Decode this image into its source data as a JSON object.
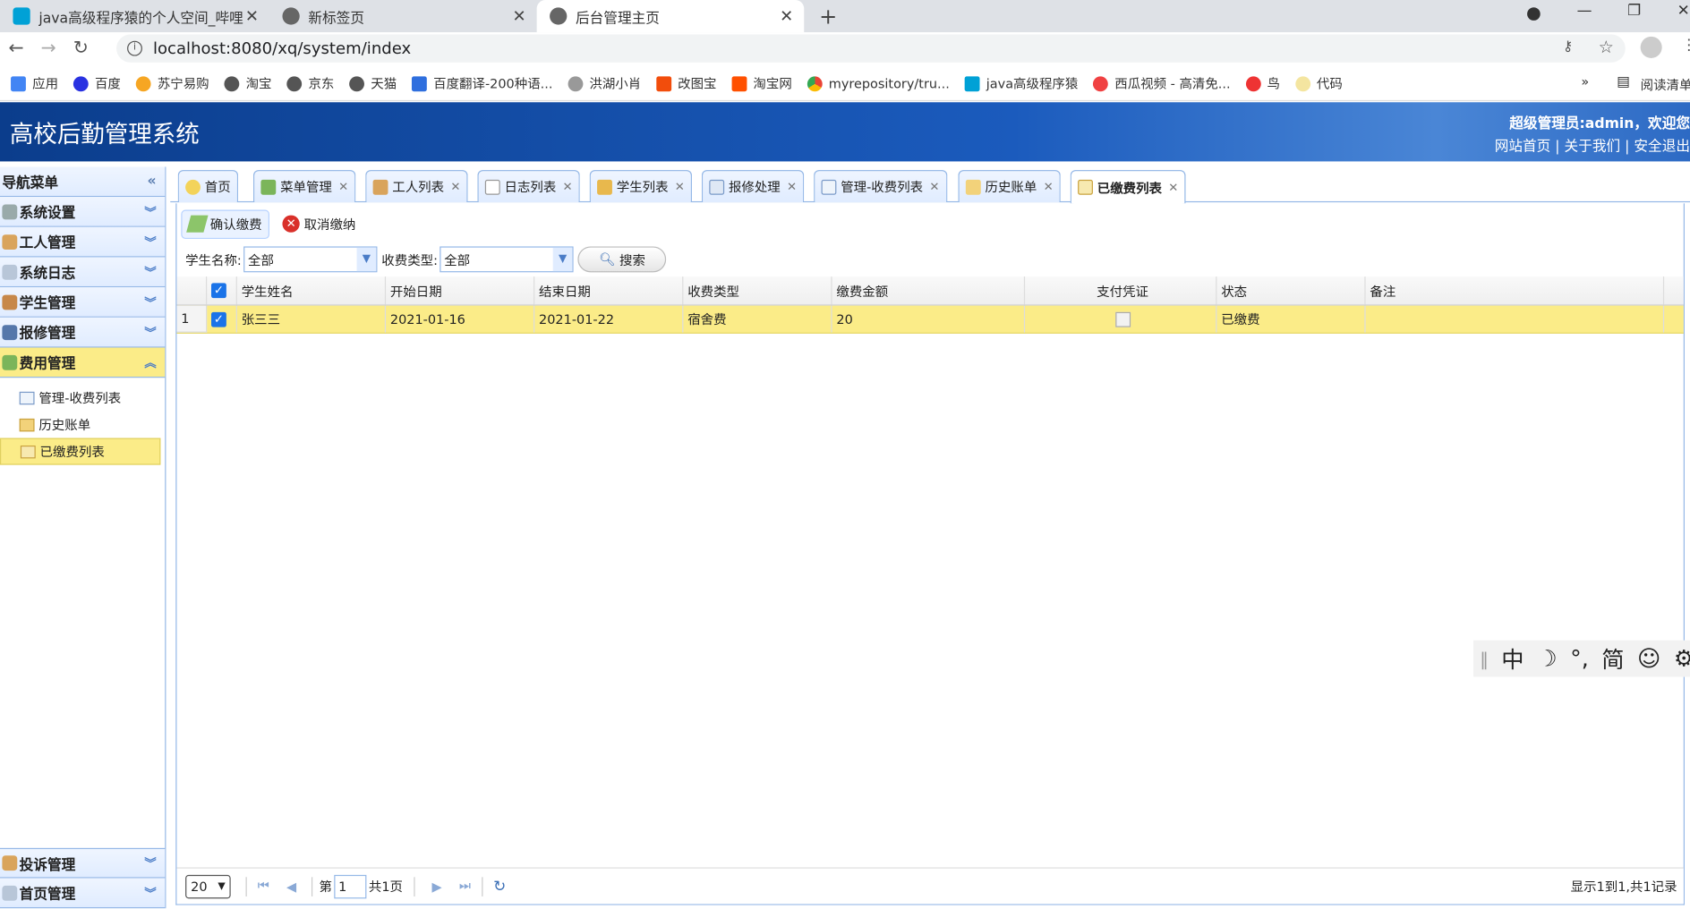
{
  "browser": {
    "tabs": [
      {
        "label": "java高级程序猿的个人空间_哔哩"
      },
      {
        "label": "新标签页"
      },
      {
        "label": "后台管理主页"
      }
    ],
    "url": "localhost:8080/xq/system/index",
    "bookmarks": [
      "应用",
      "百度",
      "苏宁易购",
      "淘宝",
      "京东",
      "天猫",
      "百度翻译-200种语...",
      "洪湖小肖",
      "改图宝",
      "淘宝网",
      "myrepository/tru...",
      "java高级程序猿",
      "西瓜视频 - 高清免...",
      "鸟",
      "代码"
    ],
    "bookmark_more": "»",
    "reading_list": "阅读清单"
  },
  "header": {
    "title": "高校后勤管理系统",
    "user": "超级管理员:admin，欢迎您",
    "links": "网站首页 | 关于我们 | 安全退出"
  },
  "sidebar": {
    "title": "导航菜单",
    "panels": [
      {
        "label": "系统设置"
      },
      {
        "label": "工人管理"
      },
      {
        "label": "系统日志"
      },
      {
        "label": "学生管理"
      },
      {
        "label": "报修管理"
      },
      {
        "label": "费用管理"
      }
    ],
    "subitems": [
      {
        "label": "管理-收费列表"
      },
      {
        "label": "历史账单"
      },
      {
        "label": "已缴费列表"
      }
    ],
    "bottom_panels": [
      {
        "label": "投诉管理"
      },
      {
        "label": "首页管理"
      }
    ]
  },
  "tabs": [
    {
      "label": "首页"
    },
    {
      "label": "菜单管理"
    },
    {
      "label": "工人列表"
    },
    {
      "label": "日志列表"
    },
    {
      "label": "学生列表"
    },
    {
      "label": "报修处理"
    },
    {
      "label": "管理-收费列表"
    },
    {
      "label": "历史账单"
    },
    {
      "label": "已缴费列表"
    }
  ],
  "toolbar": {
    "confirm": "确认缴费",
    "cancel": "取消缴纳"
  },
  "filter": {
    "student_label": "学生名称:",
    "student_value": "全部",
    "type_label": "收费类型:",
    "type_value": "全部",
    "search": "搜索"
  },
  "grid": {
    "columns": [
      "学生姓名",
      "开始日期",
      "结束日期",
      "收费类型",
      "缴费金额",
      "支付凭证",
      "状态",
      "备注"
    ],
    "rows": [
      {
        "num": "1",
        "name": "张三三",
        "start": "2021-01-16",
        "end": "2021-01-22",
        "type": "宿舍费",
        "amount": "20",
        "voucher": "",
        "status": "已缴费",
        "remark": ""
      }
    ]
  },
  "pager": {
    "size": "20",
    "page_prefix": "第",
    "page": "1",
    "page_suffix": "共1页",
    "summary": "显示1到1,共1记录"
  },
  "ime": [
    "中",
    "☽",
    "°,",
    "简",
    "☺",
    "⚙"
  ]
}
